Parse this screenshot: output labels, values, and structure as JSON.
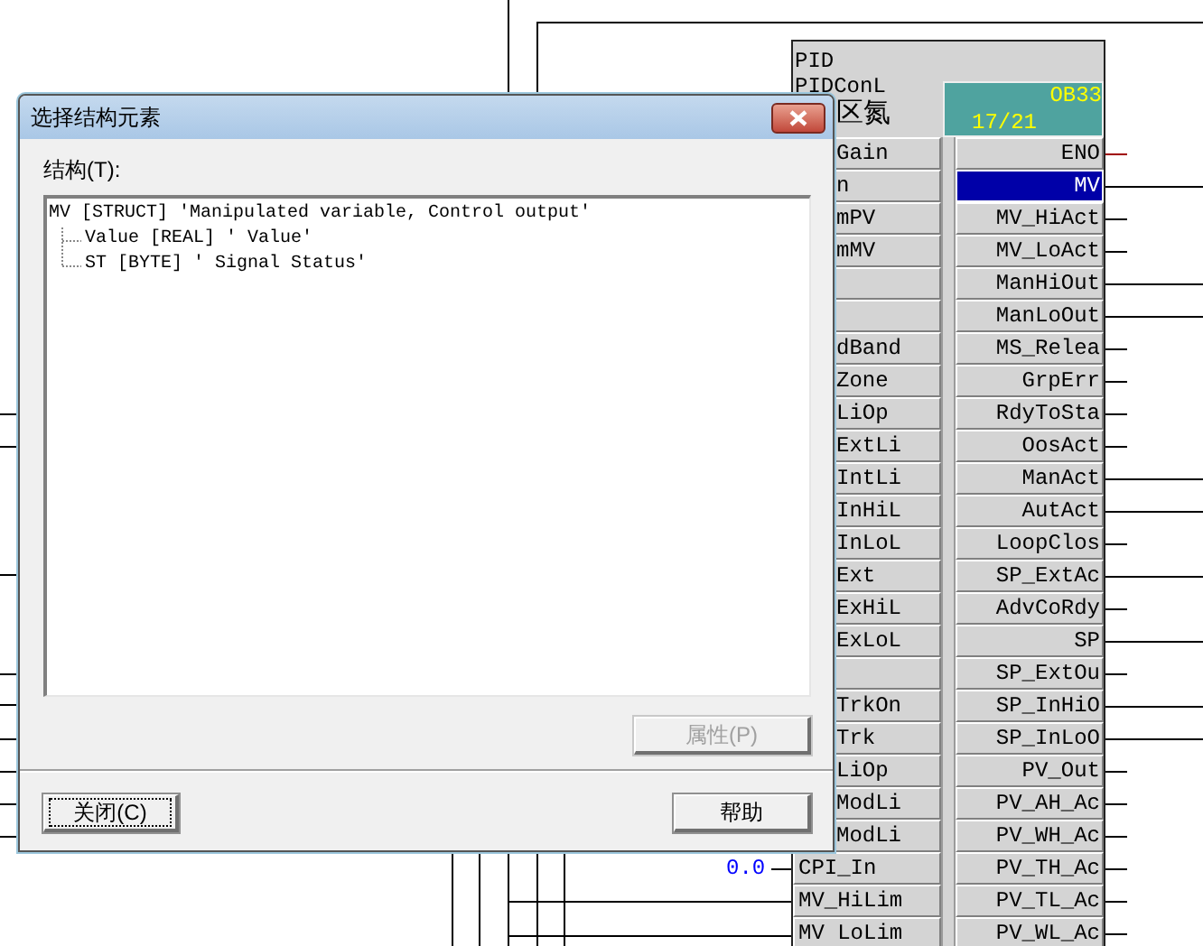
{
  "function_block": {
    "header": [
      "PID",
      "PIDConL",
      "区氮"
    ],
    "instance": {
      "ob": "OB33",
      "counter": "17/21"
    },
    "inputs": [
      {
        "kind": "pin",
        "label": "Gain"
      },
      {
        "kind": "pin",
        "label": "n"
      },
      {
        "kind": "pin",
        "label": "mPV"
      },
      {
        "kind": "pin",
        "label": "mMV"
      },
      {
        "kind": "blank"
      },
      {
        "kind": "blank"
      },
      {
        "kind": "pin",
        "label": "dBand"
      },
      {
        "kind": "pin",
        "label": "Zone"
      },
      {
        "kind": "pin",
        "label": "LiOp"
      },
      {
        "kind": "pin",
        "label": "ExtLi"
      },
      {
        "kind": "pin",
        "label": "IntLi"
      },
      {
        "kind": "pin",
        "label": "InHiL"
      },
      {
        "kind": "pin",
        "label": "InLoL"
      },
      {
        "kind": "pin",
        "label": "Ext"
      },
      {
        "kind": "pin",
        "label": "ExHiL"
      },
      {
        "kind": "pin",
        "label": "ExLoL"
      },
      {
        "kind": "blank"
      },
      {
        "kind": "pin",
        "label": "TrkOn"
      },
      {
        "kind": "pin",
        "label": "Trk"
      },
      {
        "kind": "pin",
        "label": "LiOp"
      },
      {
        "kind": "pin",
        "label": "ModLi"
      },
      {
        "kind": "pin",
        "label": "ModLi"
      },
      {
        "kind": "pin",
        "label": "CPI_In",
        "value": "0.0"
      },
      {
        "kind": "pin",
        "label": "MV_HiLim"
      },
      {
        "kind": "pin",
        "label": "MV LoLim"
      }
    ],
    "outputs": [
      {
        "label": "ENO",
        "selected": false
      },
      {
        "label": "MV",
        "selected": true
      },
      {
        "label": "MV_HiAct",
        "selected": false
      },
      {
        "label": "MV_LoAct",
        "selected": false
      },
      {
        "label": "ManHiOut",
        "selected": false
      },
      {
        "label": "ManLoOut",
        "selected": false
      },
      {
        "label": "MS_Relea",
        "selected": false
      },
      {
        "label": "GrpErr",
        "selected": false
      },
      {
        "label": "RdyToSta",
        "selected": false
      },
      {
        "label": "OosAct",
        "selected": false
      },
      {
        "label": "ManAct",
        "selected": false
      },
      {
        "label": "AutAct",
        "selected": false
      },
      {
        "label": "LoopClos",
        "selected": false
      },
      {
        "label": "SP_ExtAc",
        "selected": false
      },
      {
        "label": "AdvCoRdy",
        "selected": false
      },
      {
        "label": "SP",
        "selected": false
      },
      {
        "label": "SP_ExtOu",
        "selected": false
      },
      {
        "label": "SP_InHiO",
        "selected": false
      },
      {
        "label": "SP_InLoO",
        "selected": false
      },
      {
        "label": "PV_Out",
        "selected": false
      },
      {
        "label": "PV_AH_Ac",
        "selected": false
      },
      {
        "label": "PV_WH_Ac",
        "selected": false
      },
      {
        "label": "PV_TH_Ac",
        "selected": false
      },
      {
        "label": "PV_TL_Ac",
        "selected": false
      },
      {
        "label": "PV_WL_Ac",
        "selected": false
      }
    ]
  },
  "dialog": {
    "title": "选择结构元素",
    "tree_label": "结构(T):",
    "tree": [
      {
        "text": "MV [STRUCT] 'Manipulated variable, Control output'",
        "children": [
          {
            "text": "Value [REAL] ' Value'"
          },
          {
            "text": "ST [BYTE] ' Signal Status'"
          }
        ]
      }
    ],
    "buttons": [
      {
        "kind": "properties",
        "label": "属性(P)",
        "disabled": true,
        "focused": false
      },
      {
        "kind": "close",
        "label": "关闭(C)",
        "disabled": false,
        "focused": true
      },
      {
        "kind": "help",
        "label": "帮助",
        "disabled": false,
        "focused": false
      }
    ]
  }
}
